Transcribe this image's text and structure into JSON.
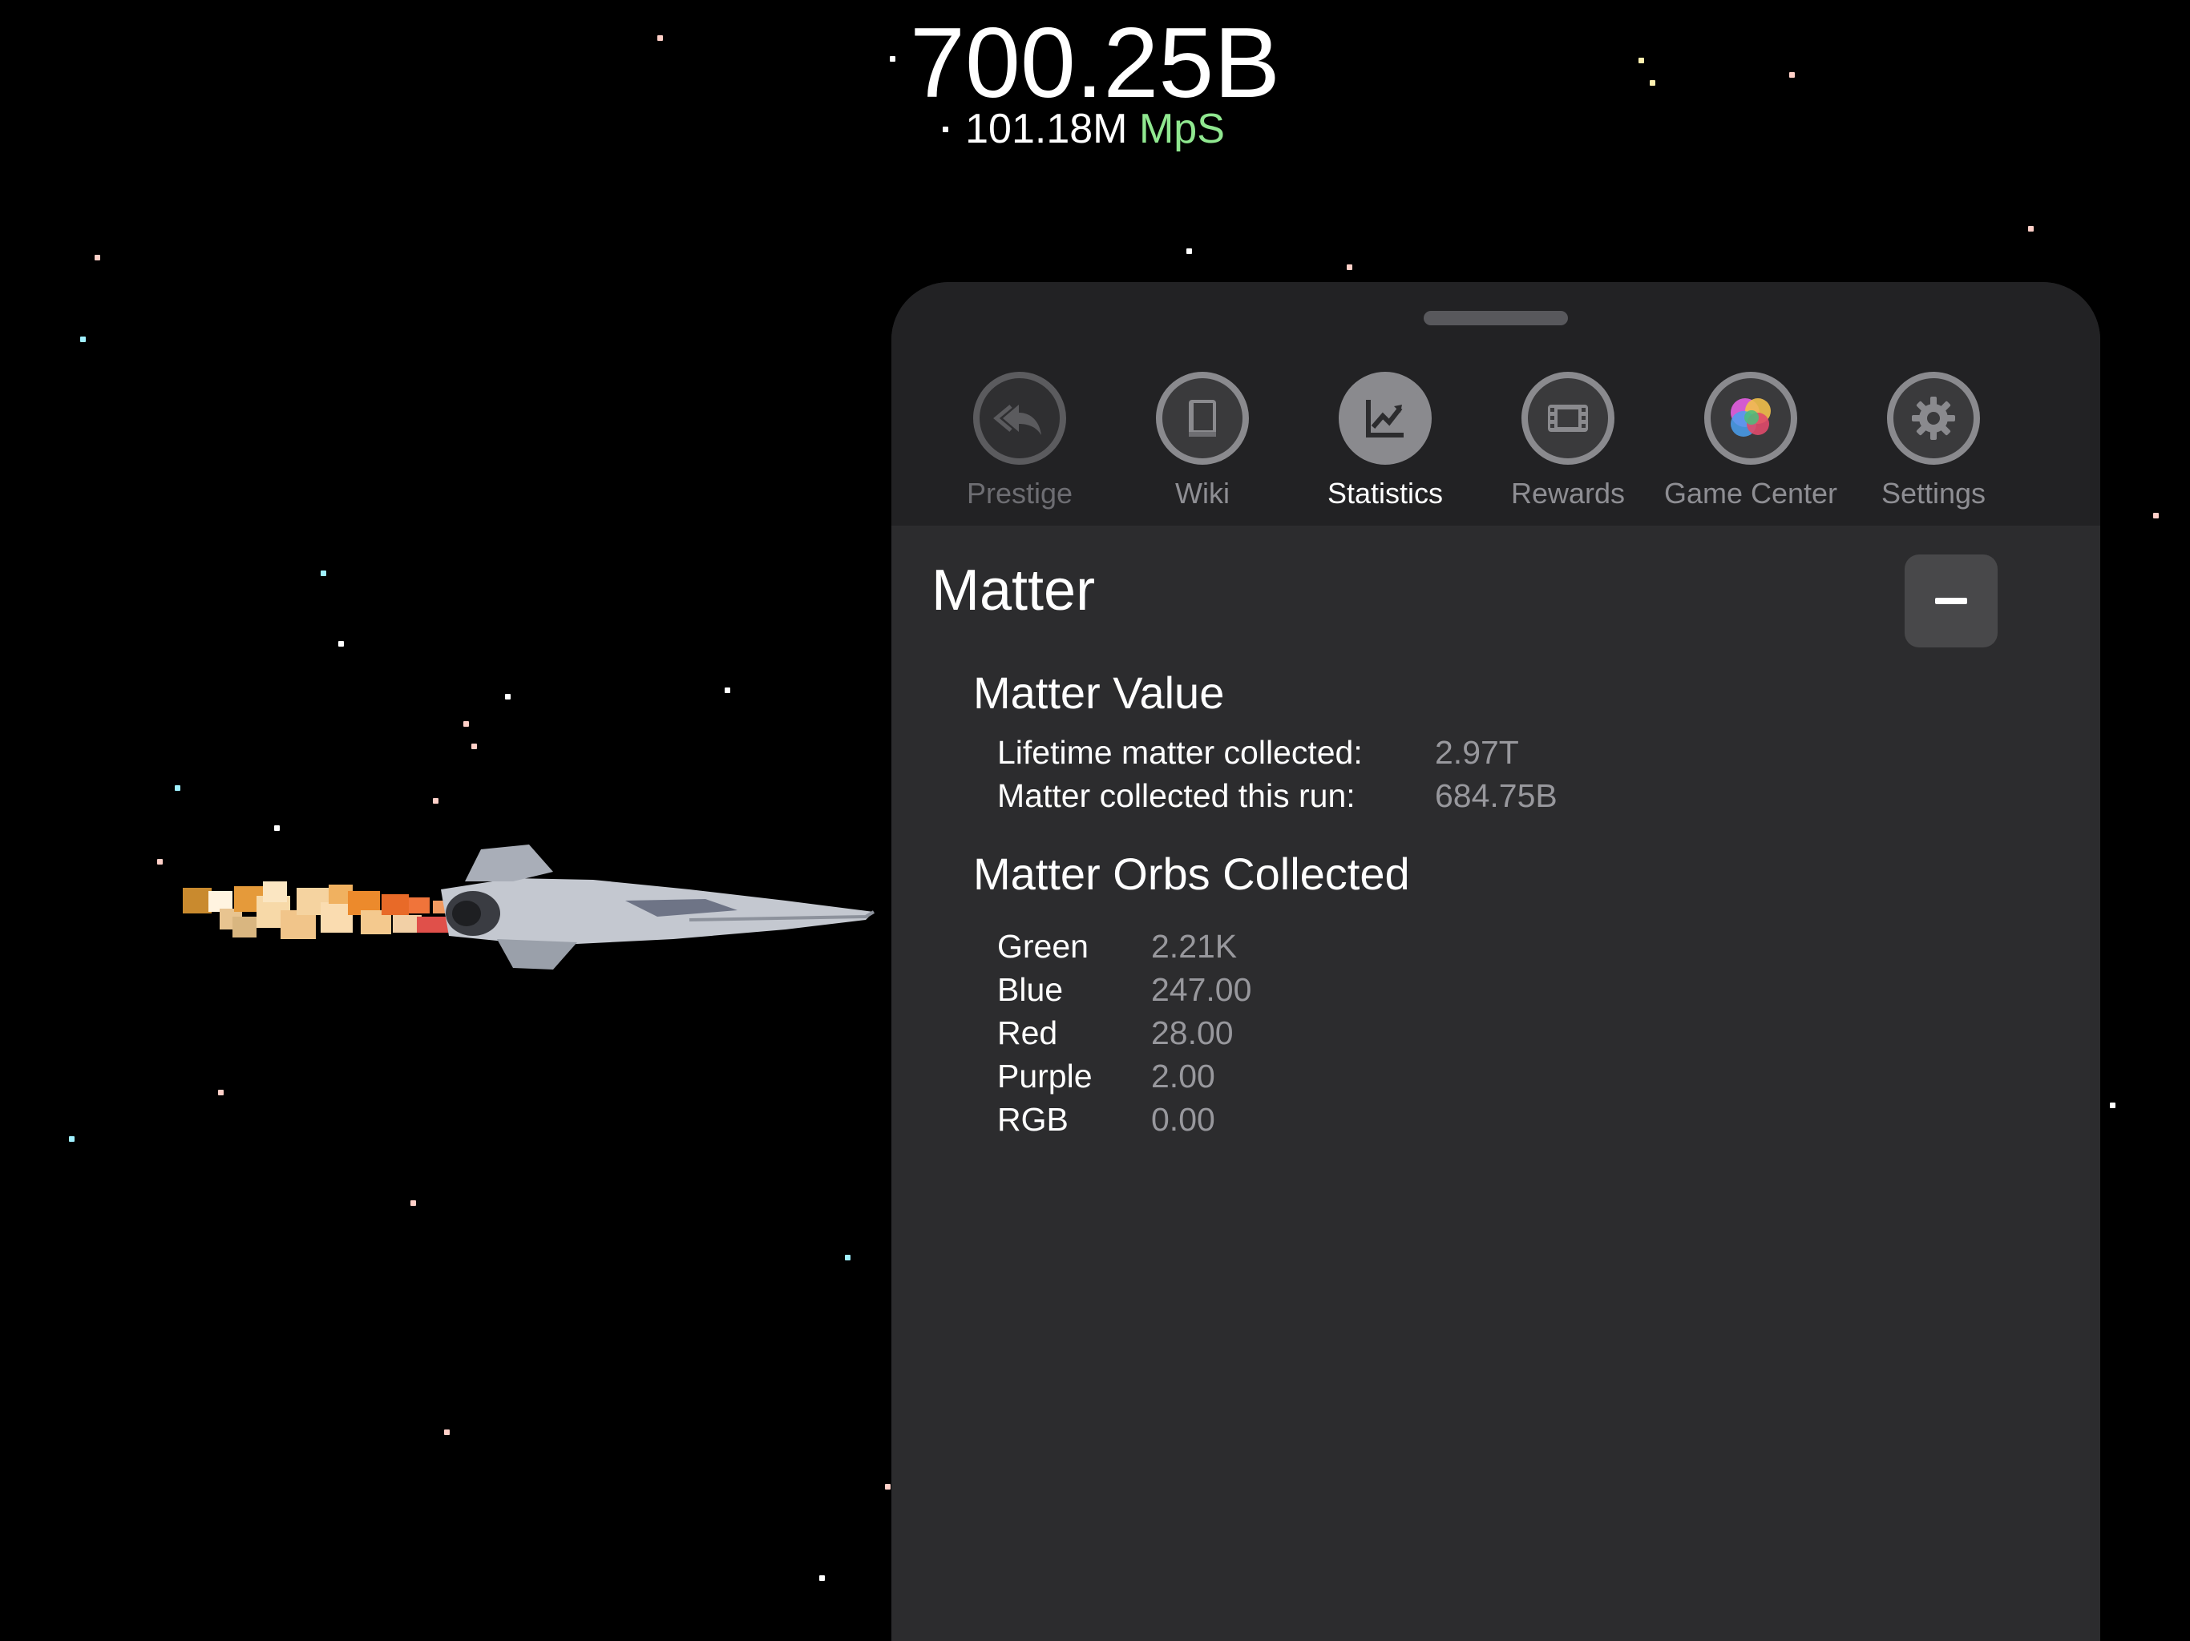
{
  "hud": {
    "matter_total": "700.25B",
    "matter_rate_value": "101.18M",
    "matter_rate_unit": "MpS"
  },
  "tabs": [
    {
      "label": "Prestige",
      "icon": "prestige-icon",
      "state": "disabled"
    },
    {
      "label": "Wiki",
      "icon": "book-icon",
      "state": "normal"
    },
    {
      "label": "Statistics",
      "icon": "chart-icon",
      "state": "selected"
    },
    {
      "label": "Rewards",
      "icon": "film-icon",
      "state": "normal"
    },
    {
      "label": "Game Center",
      "icon": "game-center-icon",
      "state": "normal"
    },
    {
      "label": "Settings",
      "icon": "gear-icon",
      "state": "normal"
    }
  ],
  "section": {
    "title": "Matter",
    "collapse_icon": "minus-icon",
    "matter_value": {
      "title": "Matter Value",
      "rows": [
        {
          "label": "Lifetime matter collected:",
          "value": "2.97T"
        },
        {
          "label": "Matter collected this run:",
          "value": "684.75B"
        }
      ]
    },
    "orbs": {
      "title": "Matter Orbs Collected",
      "rows": [
        {
          "label": "Green",
          "value": "2.21K"
        },
        {
          "label": "Blue",
          "value": "247.00"
        },
        {
          "label": "Red",
          "value": "28.00"
        },
        {
          "label": "Purple",
          "value": "2.00"
        },
        {
          "label": "RGB",
          "value": "0.00"
        }
      ]
    }
  },
  "colors": {
    "background": "#000000",
    "panel": "#2c2c2e",
    "panel_header": "#222224",
    "rate_unit": "#90e890",
    "muted_text": "#98989d"
  }
}
